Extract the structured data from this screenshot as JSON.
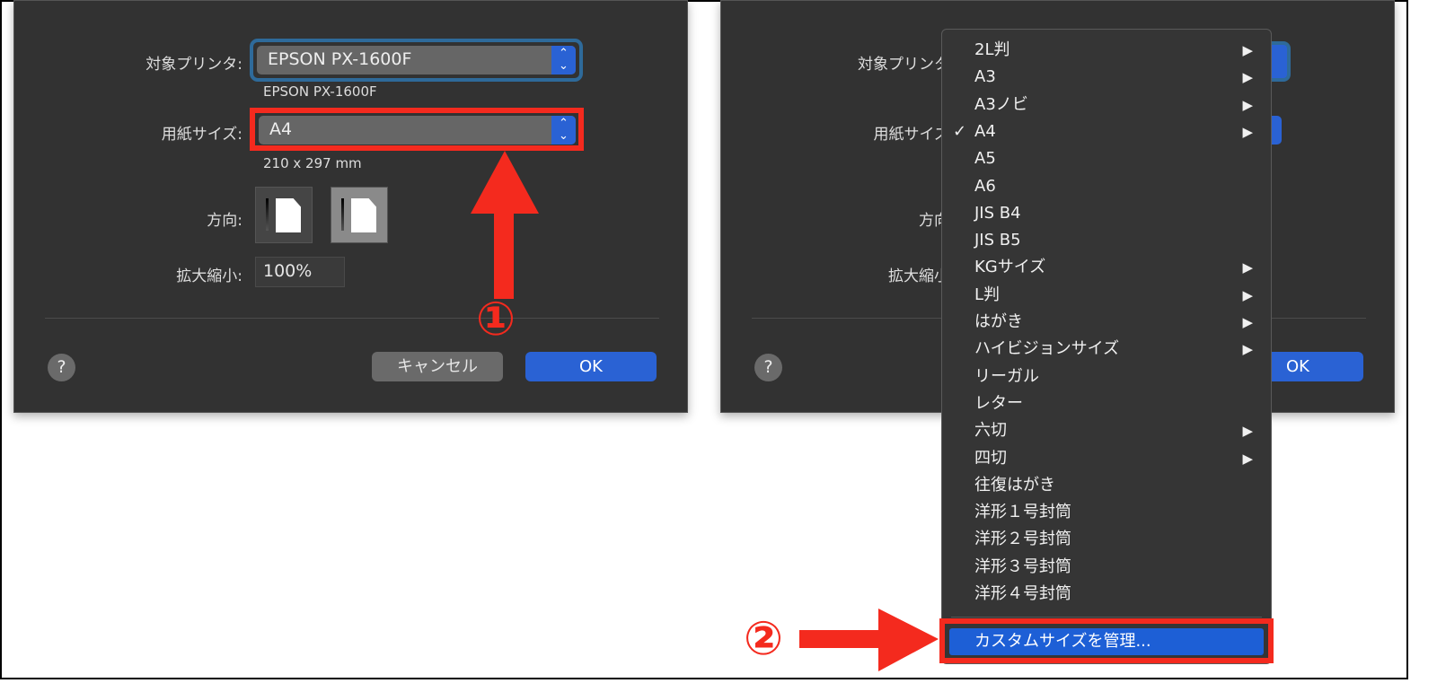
{
  "left_dialog": {
    "printer_label": "対象プリンタ:",
    "printer_value": "EPSON PX-1600F",
    "printer_sub": "EPSON PX-1600F",
    "paper_label": "用紙サイズ:",
    "paper_value": "A4",
    "paper_dims": "210 x 297 mm",
    "orientation_label": "方向:",
    "scale_label": "拡大縮小:",
    "scale_value": "100%",
    "help": "?",
    "cancel": "キャンセル",
    "ok": "OK"
  },
  "right_dialog": {
    "printer_label": "対象プリンタ",
    "paper_label": "用紙サイズ",
    "orientation_label": "方向",
    "scale_label": "拡大縮小",
    "help": "?",
    "ok": "OK"
  },
  "menu": {
    "items": [
      {
        "label": "2L判",
        "sub": true
      },
      {
        "label": "A3",
        "sub": true
      },
      {
        "label": "A3ノビ",
        "sub": true
      },
      {
        "label": "A4",
        "sub": true,
        "checked": true
      },
      {
        "label": "A5"
      },
      {
        "label": "A6"
      },
      {
        "label": "JIS B4"
      },
      {
        "label": "JIS B5"
      },
      {
        "label": "KGサイズ",
        "sub": true
      },
      {
        "label": "L判",
        "sub": true
      },
      {
        "label": "はがき",
        "sub": true
      },
      {
        "label": "ハイビジョンサイズ",
        "sub": true
      },
      {
        "label": "リーガル"
      },
      {
        "label": "レター"
      },
      {
        "label": "六切",
        "sub": true
      },
      {
        "label": "四切",
        "sub": true
      },
      {
        "label": "往復はがき"
      },
      {
        "label": "洋形１号封筒"
      },
      {
        "label": "洋形２号封筒"
      },
      {
        "label": "洋形３号封筒"
      },
      {
        "label": "洋形４号封筒"
      }
    ],
    "custom": "カスタムサイズを管理...",
    "check": "✓",
    "submenu": "▶"
  },
  "annotations": {
    "step1": "①",
    "step2": "②"
  },
  "colors": {
    "accent": "#2a62d4",
    "highlight": "#f42a1e"
  }
}
